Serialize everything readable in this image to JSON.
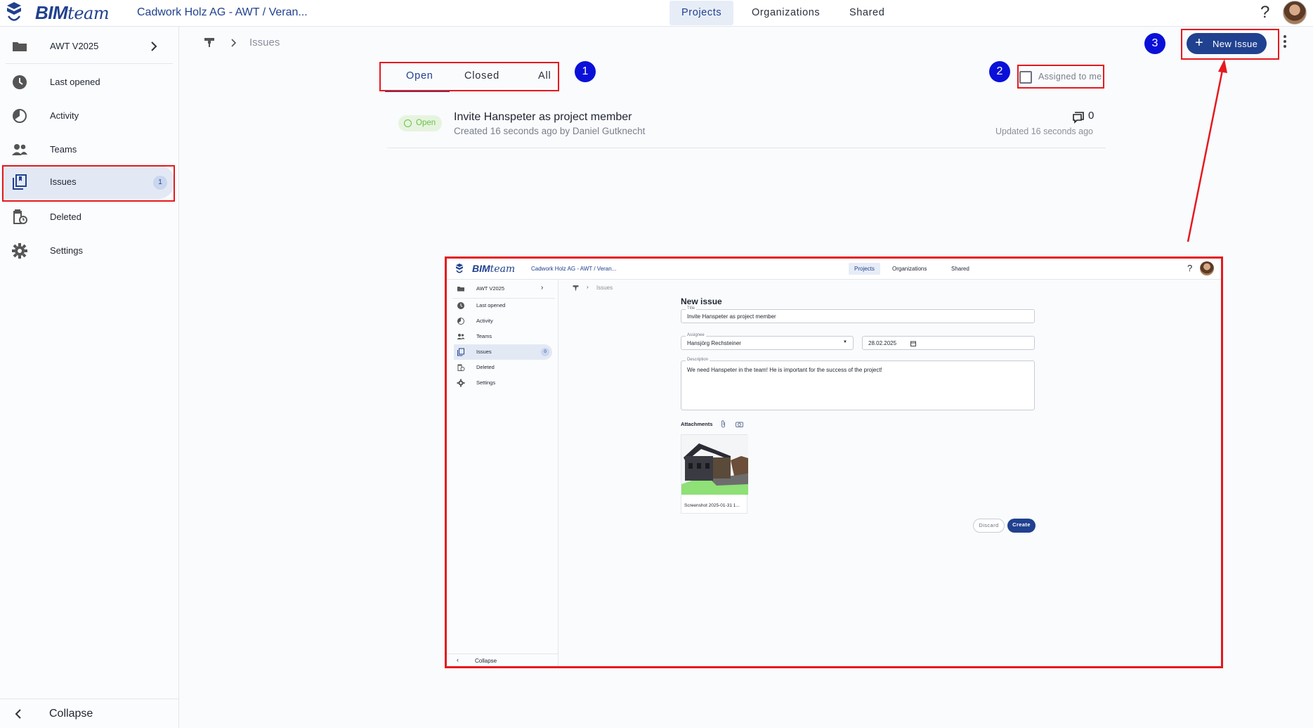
{
  "topbar": {
    "brand_bim": "BIM",
    "brand_team": "team",
    "project_title": "Cadwork Holz AG - AWT / Veran...",
    "tabs": [
      {
        "label": "Projects",
        "active": true
      },
      {
        "label": "Organizations",
        "active": false
      },
      {
        "label": "Shared",
        "active": false
      }
    ],
    "help": "?"
  },
  "sidebar": {
    "project": "AWT V2025",
    "items": [
      {
        "label": "Last opened",
        "icon": "clock-icon"
      },
      {
        "label": "Activity",
        "icon": "activity-icon"
      },
      {
        "label": "Teams",
        "icon": "teams-icon"
      },
      {
        "label": "Issues",
        "icon": "issues-icon",
        "badge": "1",
        "active": true
      },
      {
        "label": "Deleted",
        "icon": "deleted-icon"
      },
      {
        "label": "Settings",
        "icon": "gear-icon"
      }
    ],
    "collapse": "Collapse"
  },
  "main": {
    "breadcrumb": {
      "current": "Issues"
    },
    "filters": {
      "tabs": [
        "Open",
        "Closed",
        "All"
      ],
      "active": "Open"
    },
    "assigned_to_me": "Assigned to me",
    "new_issue": "New Issue",
    "markers": [
      "1",
      "2",
      "3"
    ],
    "issues": [
      {
        "status": "Open",
        "title": "Invite Hanspeter as project member",
        "meta": "Created 16 seconds ago by Daniel Gutknecht",
        "comments": "0",
        "updated": "Updated 16 seconds ago"
      }
    ]
  },
  "embedded": {
    "brand_bim": "BIM",
    "brand_team": "team",
    "project_title": "Cadwork Holz AG - AWT / Veran...",
    "tabs": [
      "Projects",
      "Organizations",
      "Shared"
    ],
    "help": "?",
    "sidebar_project": "AWT V2025",
    "sidebar_items": [
      "Last opened",
      "Activity",
      "Teams",
      "Issues",
      "Deleted",
      "Settings"
    ],
    "issues_badge": "0",
    "collapse": "Collapse",
    "breadcrumb": "Issues",
    "form": {
      "heading": "New issue",
      "title_label": "Title",
      "title_value": "Invite Hanspeter as project member",
      "assignee_label": "Assignee",
      "assignee_value": "Hansjörg Rechsteiner",
      "date_value": "28.02.2025",
      "description_label": "Description",
      "description_value": "We need Hanspeter in the team! He is important for the success of the project!",
      "attachments_label": "Attachments",
      "attachment_caption": "Screenshot 2025-01-31 1...",
      "discard": "Discard",
      "create": "Create"
    }
  },
  "colors": {
    "brand": "#20418f",
    "highlight": "#e5191e",
    "marker": "#0a10d8",
    "open_status": "#6cbf4a"
  }
}
